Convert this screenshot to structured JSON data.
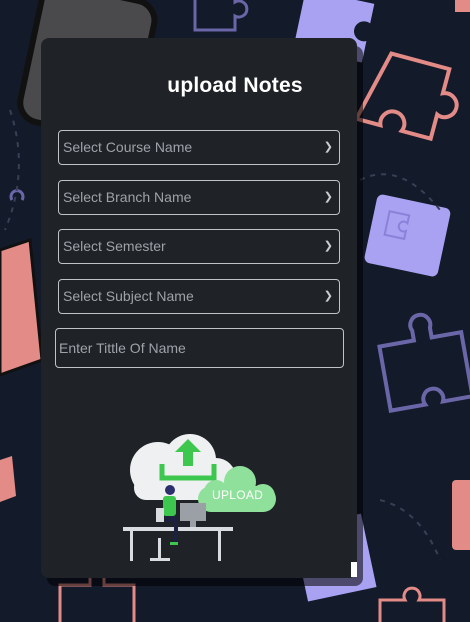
{
  "form": {
    "title": "upload Notes",
    "course_select": {
      "placeholder": "Select Course Name"
    },
    "branch_select": {
      "placeholder": "Select Branch Name"
    },
    "semester_select": {
      "placeholder": "Select Semester"
    },
    "subject_select": {
      "placeholder": "Select Subject Name"
    },
    "title_input": {
      "placeholder": "Enter Tittle Of Name"
    }
  },
  "illustration": {
    "cloud_label": "UPLOAD"
  },
  "colors": {
    "page_bg": "#131a2a",
    "card_bg": "#1f2226",
    "accent_green": "#3ec74f",
    "puzzle_purple": "#a9a2f2",
    "puzzle_salmon": "#e38b86"
  }
}
